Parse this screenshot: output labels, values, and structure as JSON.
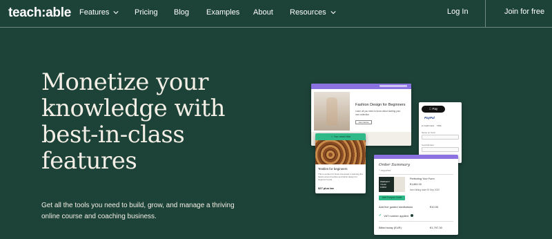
{
  "brand": {
    "logo": "teach:able"
  },
  "nav": {
    "items": [
      {
        "label": "Features",
        "has_dropdown": true
      },
      {
        "label": "Pricing",
        "has_dropdown": false
      },
      {
        "label": "Blog",
        "has_dropdown": false
      },
      {
        "label": "Examples",
        "has_dropdown": false
      },
      {
        "label": "About",
        "has_dropdown": false
      },
      {
        "label": "Resources",
        "has_dropdown": true
      }
    ],
    "login": "Log In",
    "join": "Join for free"
  },
  "hero": {
    "title_lines": [
      "Monetize your",
      "knowledge with",
      "best-in-class",
      "features"
    ],
    "subtitle_lines": [
      "Get all the tools you need to build, grow, and manage a thriving",
      "online course and coaching business."
    ]
  },
  "mockup": {
    "course_card": {
      "title": "Fashion Design for Beginners",
      "description": "Learn all you need to know about starting your own collection",
      "button": "Get course"
    },
    "textile_card": {
      "banner": "You need this",
      "title": "Textiles for beginners",
      "description": "This is perfect for those interested in learning the basics around textiles and fabric design for beginner levels",
      "price": "$27 plus tax"
    },
    "payment_card": {
      "apple_pay": "Pay",
      "paypal": "PayPal",
      "credit_card": "Credit Card",
      "card_brands": "VISA",
      "fields": [
        "Name on Card",
        "Card Number"
      ]
    },
    "order_card": {
      "title": "Order Summary",
      "required": "* required",
      "thumb_text": "PERFECT YOUR FORM",
      "item_name": "Perfecting Your Form",
      "item_price": "€1,881.00",
      "next_billing": "Next billing date 09 Sep 2020",
      "coupon_button": "Add Coupon Code",
      "addon_label": "Add five guided meditations",
      "addon_price": "€10.00",
      "vat_label": "VAT number applied",
      "billed_label": "Billed today (EUR)",
      "billed_value": "€1,797.30"
    }
  },
  "colors": {
    "background": "#1d4339",
    "hero_text": "#f4efe6",
    "accent_green": "#2fb888",
    "accent_purple": "#8a72e0"
  }
}
